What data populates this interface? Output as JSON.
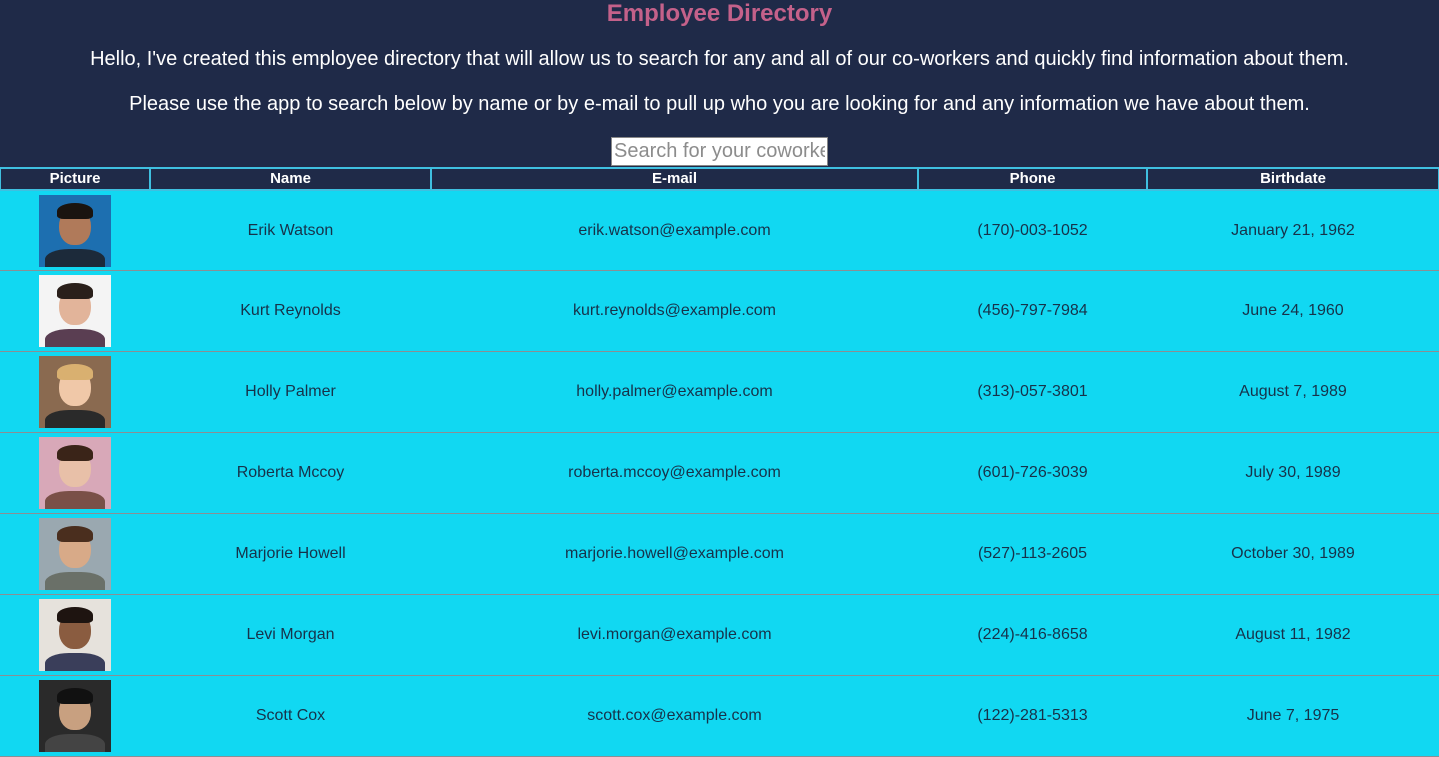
{
  "header": {
    "title": "Employee Directory",
    "intro_line1": "Hello, I've created this employee directory that will allow us to search for any and all of our co-workers and quickly find information about them.",
    "intro_line2": "Please use the app to search below by name or by e-mail to pull up who you are looking for and any information we have about them.",
    "search_placeholder": "Search for your coworker",
    "search_value": ""
  },
  "colors": {
    "background": "#1f2a48",
    "title": "#c4618a",
    "row_background": "#11d8f2",
    "header_border": "#3fbfe0"
  },
  "table": {
    "columns": [
      "Picture",
      "Name",
      "E-mail",
      "Phone",
      "Birthdate"
    ],
    "rows": [
      {
        "name": "Erik Watson",
        "email": "erik.watson@example.com",
        "phone": "(170)-003-1052",
        "birthdate": "January 21, 1962",
        "avatar": "avatar-photo"
      },
      {
        "name": "Kurt Reynolds",
        "email": "kurt.reynolds@example.com",
        "phone": "(456)-797-7984",
        "birthdate": "June 24, 1960",
        "avatar": "avatar-photo"
      },
      {
        "name": "Holly Palmer",
        "email": "holly.palmer@example.com",
        "phone": "(313)-057-3801",
        "birthdate": "August 7, 1989",
        "avatar": "avatar-photo"
      },
      {
        "name": "Roberta Mccoy",
        "email": "roberta.mccoy@example.com",
        "phone": "(601)-726-3039",
        "birthdate": "July 30, 1989",
        "avatar": "avatar-photo"
      },
      {
        "name": "Marjorie Howell",
        "email": "marjorie.howell@example.com",
        "phone": "(527)-113-2605",
        "birthdate": "October 30, 1989",
        "avatar": "avatar-photo"
      },
      {
        "name": "Levi Morgan",
        "email": "levi.morgan@example.com",
        "phone": "(224)-416-8658",
        "birthdate": "August 11, 1982",
        "avatar": "avatar-photo"
      },
      {
        "name": "Scott Cox",
        "email": "scott.cox@example.com",
        "phone": "(122)-281-5313",
        "birthdate": "June 7, 1975",
        "avatar": "avatar-photo"
      }
    ]
  }
}
